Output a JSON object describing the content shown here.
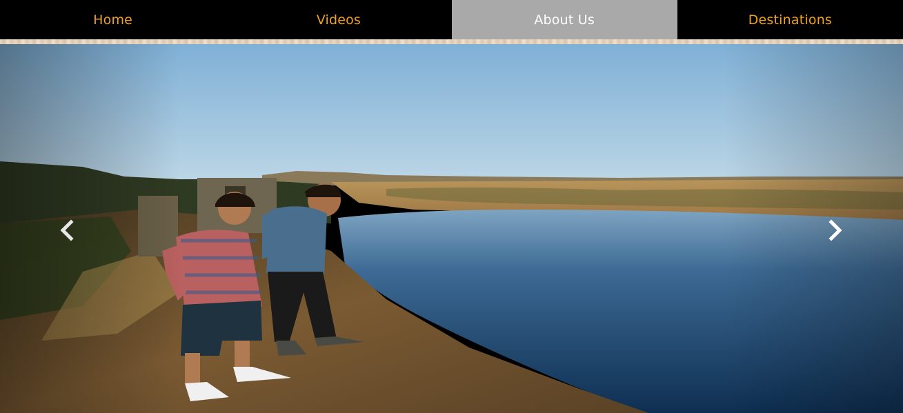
{
  "nav": {
    "items": [
      {
        "label": "Home",
        "active": false
      },
      {
        "label": "Videos",
        "active": false
      },
      {
        "label": "About Us",
        "active": true
      },
      {
        "label": "Destinations",
        "active": false
      }
    ],
    "text_color": "#f0a020",
    "active_bg": "#a9a9a9",
    "active_text": "#ffffff"
  },
  "carousel": {
    "prev_icon": "chevron-left-icon",
    "next_icon": "chevron-right-icon"
  }
}
